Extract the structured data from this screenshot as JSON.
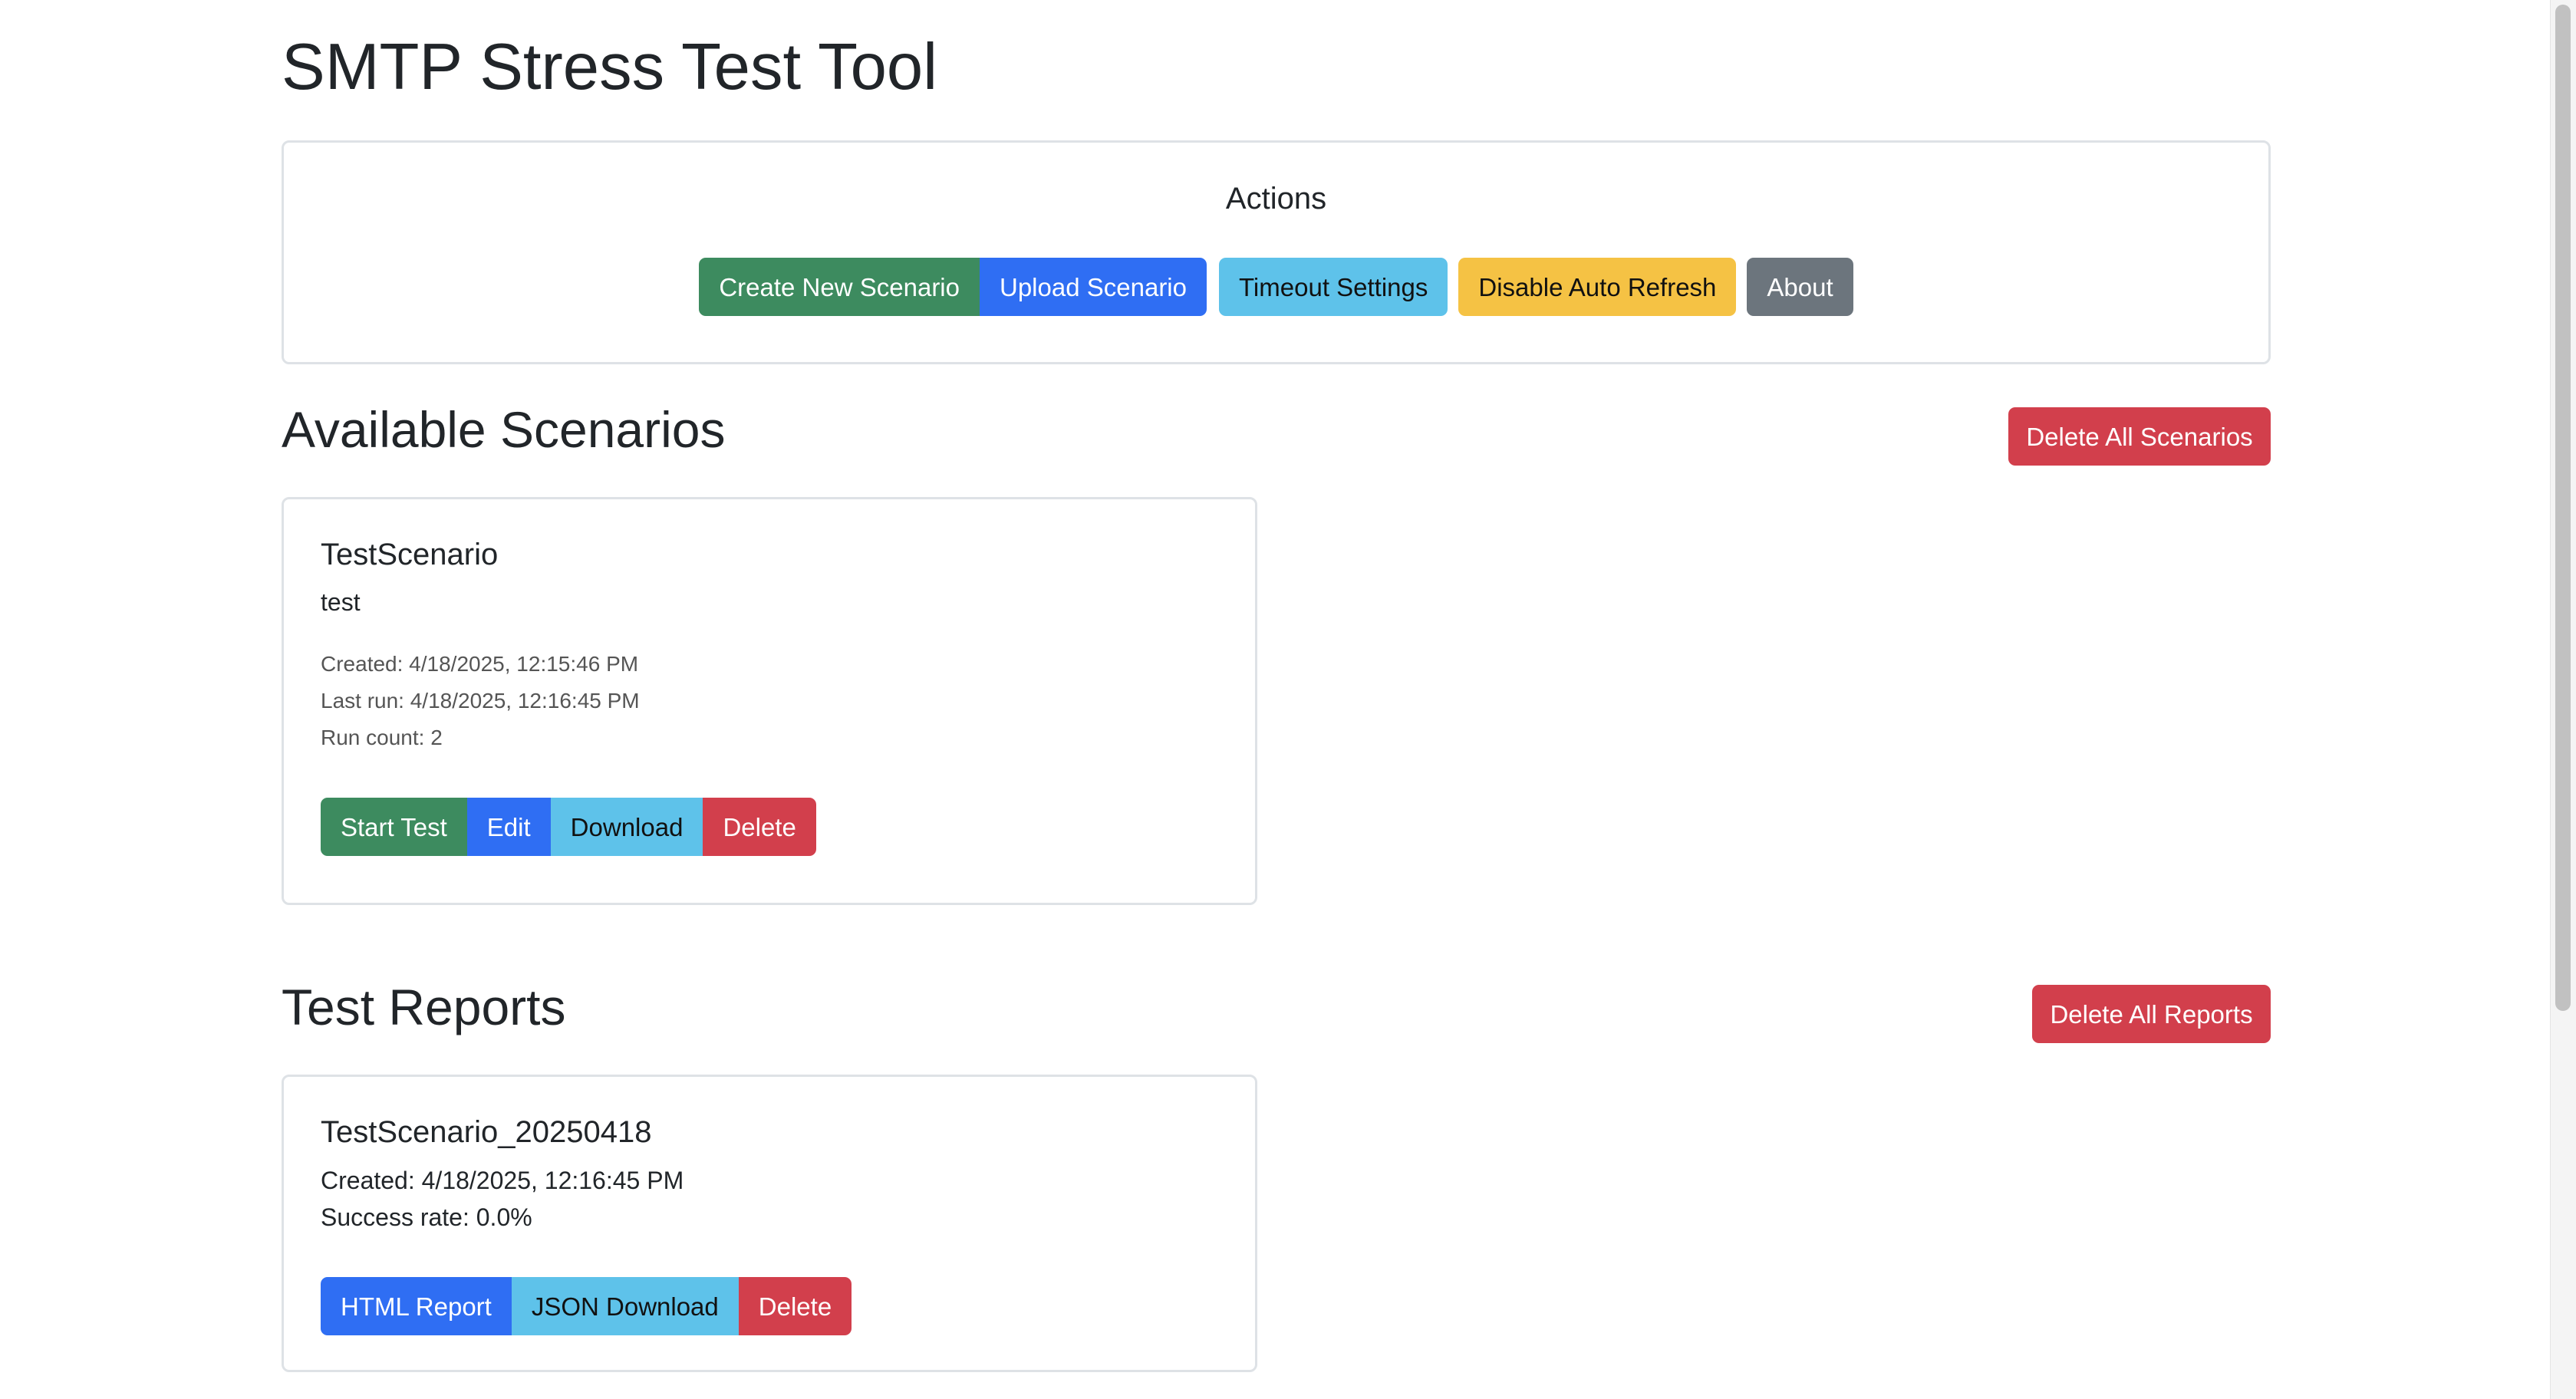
{
  "app": {
    "title": "SMTP Stress Test Tool"
  },
  "actions": {
    "title": "Actions",
    "create_new_scenario": "Create New Scenario",
    "upload_scenario": "Upload Scenario",
    "timeout_settings": "Timeout Settings",
    "disable_auto_refresh": "Disable Auto Refresh",
    "about": "About"
  },
  "scenarios": {
    "title": "Available Scenarios",
    "delete_all": "Delete All Scenarios",
    "items": [
      {
        "name": "TestScenario",
        "description": "test",
        "created": "Created: 4/18/2025, 12:15:46 PM",
        "last_run": "Last run: 4/18/2025, 12:16:45 PM",
        "run_count": "Run count: 2",
        "start_test": "Start Test",
        "edit": "Edit",
        "download": "Download",
        "delete": "Delete"
      }
    ]
  },
  "reports": {
    "title": "Test Reports",
    "delete_all": "Delete All Reports",
    "items": [
      {
        "name": "TestScenario_20250418",
        "created": "Created: 4/18/2025, 12:16:45 PM",
        "success_rate": "Success rate: 0.0%",
        "html_report": "HTML Report",
        "json_download": "JSON Download",
        "delete": "Delete"
      }
    ]
  },
  "colors": {
    "success": "#3d8b5f",
    "primary": "#2f6ef3",
    "info": "#5ec2ea",
    "warning": "#f5c244",
    "secondary": "#6c757d",
    "danger": "#d23f4c"
  }
}
